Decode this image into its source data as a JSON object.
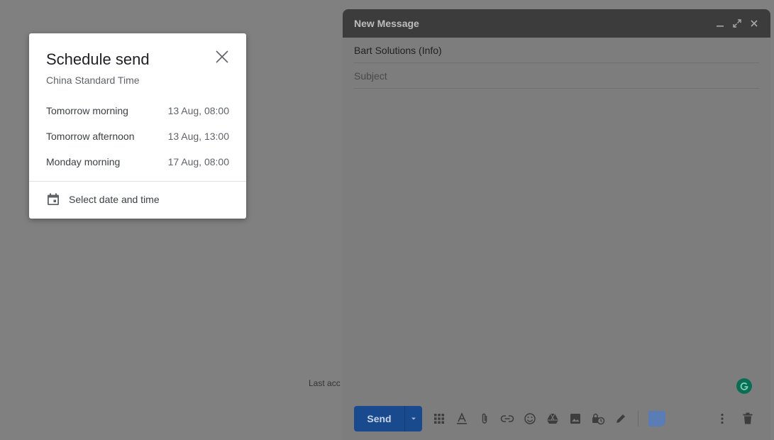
{
  "background": {
    "partial_text": "Last acc"
  },
  "compose": {
    "title": "New Message",
    "to_value": "Bart Solutions (Info)",
    "subject_placeholder": "Subject",
    "send_label": "Send",
    "icons": [
      "minimize-icon",
      "expand-icon",
      "close-icon",
      "apps-icon",
      "format-text-icon",
      "attach-icon",
      "link-icon",
      "emoji-icon",
      "drive-icon",
      "photo-icon",
      "confidential-icon",
      "signature-icon",
      "more-options-icon",
      "trash-icon"
    ],
    "colors": {
      "header": "#3c3c3c",
      "send": "#1a4a8e",
      "grammarly": "#0a6e54"
    }
  },
  "schedule": {
    "title": "Schedule send",
    "timezone": "China Standard Time",
    "options": [
      {
        "label": "Tomorrow morning",
        "time": "13 Aug, 08:00"
      },
      {
        "label": "Tomorrow afternoon",
        "time": "13 Aug, 13:00"
      },
      {
        "label": "Monday morning",
        "time": "17 Aug, 08:00"
      }
    ],
    "custom_label": "Select date and time"
  }
}
